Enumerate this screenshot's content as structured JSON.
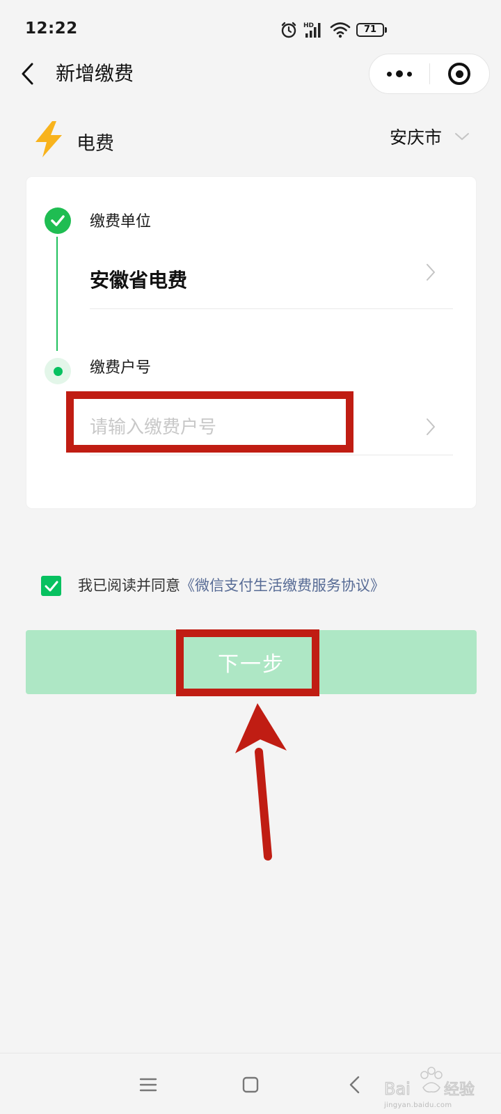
{
  "status_bar": {
    "time": "12:22",
    "battery": "71",
    "icons": [
      "alarm-icon",
      "hd-icon",
      "signal-icon",
      "wifi-icon",
      "battery-icon"
    ]
  },
  "nav": {
    "title": "新增缴费",
    "back_icon": "chevron-left-icon",
    "menu_icon": "more-dots-icon",
    "close_icon": "target-icon"
  },
  "service": {
    "name": "电费",
    "icon": "lightning-icon",
    "icon_color": "#f8b31d",
    "city": "安庆市"
  },
  "form": {
    "unit_label": "缴费单位",
    "unit_value": "安徽省电费",
    "account_label": "缴费户号",
    "account_value": "",
    "account_placeholder": "请输入缴费户号"
  },
  "agreement": {
    "checked": true,
    "text": "我已阅读并同意",
    "link": "《微信支付生活缴费服务协议》"
  },
  "next_button": {
    "label": "下一步",
    "enabled": false,
    "color": "#aee7c5"
  },
  "colors": {
    "accent_green": "#07c160",
    "annotation_red": "#c01d13",
    "link_blue": "#576b95"
  },
  "watermark": {
    "brand": "Baidu经验",
    "url": "jingyan.baidu.com"
  }
}
